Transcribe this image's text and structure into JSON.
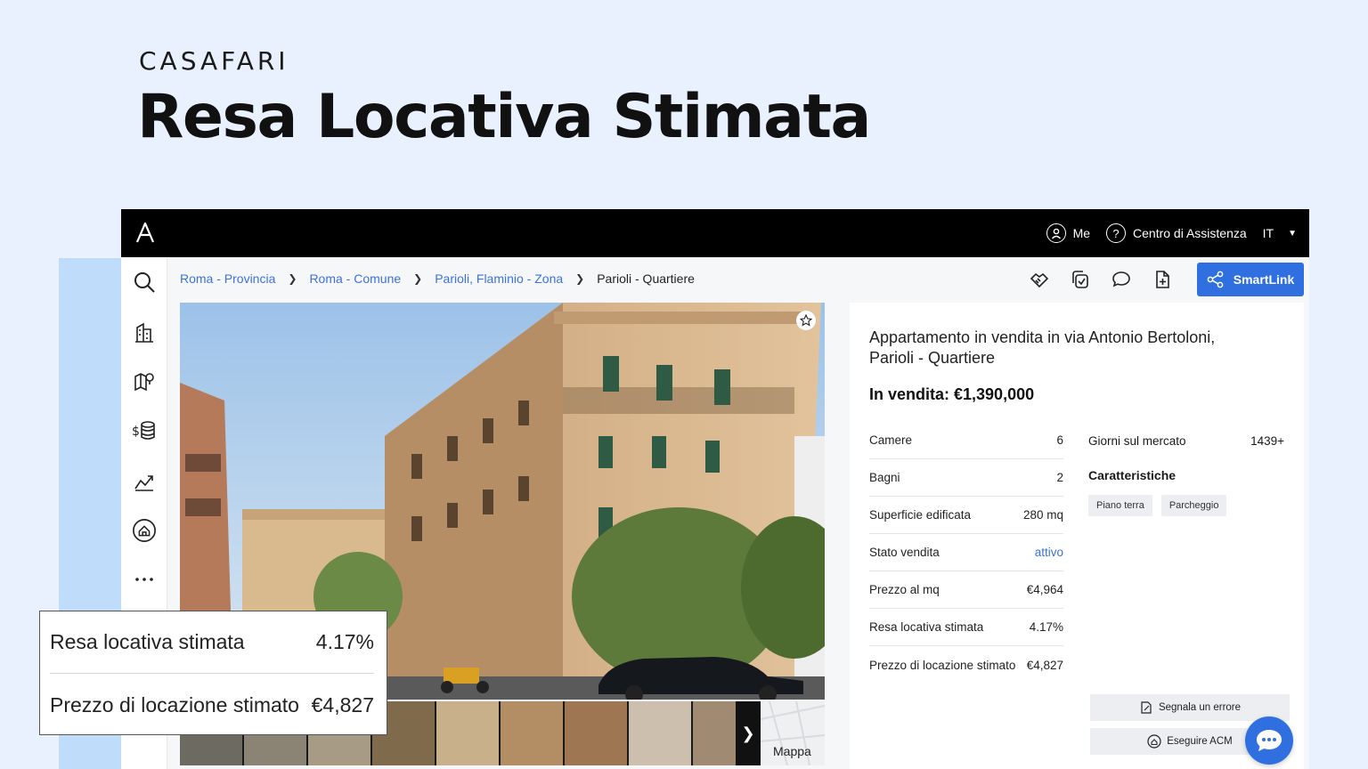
{
  "brand": "CASAFARI",
  "hero_title": "Resa Locativa Stimata",
  "topbar": {
    "me_label": "Me",
    "help_label": "Centro di Assistenza",
    "lang_label": "IT"
  },
  "sidebar": {
    "icons": [
      "search-icon",
      "building-icon",
      "map-pin-icon",
      "money-stack-icon",
      "chart-icon",
      "home-target-icon",
      "more-icon"
    ]
  },
  "breadcrumb": [
    {
      "label": "Roma - Provincia"
    },
    {
      "label": "Roma - Comune"
    },
    {
      "label": "Parioli, Flaminio - Zona"
    },
    {
      "label": "Parioli - Quartiere"
    }
  ],
  "toolbar": {
    "smartlink_label": "SmartLink"
  },
  "gallery": {
    "map_label": "Mappa"
  },
  "listing": {
    "title": "Appartamento in vendita in via Antonio Bertoloni, Parioli - Quartiere",
    "price": "In vendita: €1,390,000",
    "facts": [
      {
        "label": "Camere",
        "value": "6"
      },
      {
        "label": "Bagni",
        "value": "2"
      },
      {
        "label": "Superficie edificata",
        "value": "280 mq"
      },
      {
        "label": "Stato vendita",
        "value": "attivo"
      },
      {
        "label": "Prezzo al mq",
        "value": "€4,964"
      },
      {
        "label": "Resa locativa stimata",
        "value": "4.17%"
      },
      {
        "label": "Prezzo di locazione stimato",
        "value": "€4,827"
      }
    ],
    "days_label": "Giorni sul mercato",
    "days_value": "1439+",
    "features_title": "Caratteristiche",
    "features": [
      "Piano terra",
      "Parcheggio"
    ],
    "report_error_label": "Segnala un errore",
    "acm_label": "Eseguire ACM"
  },
  "callout": {
    "yield_label": "Resa locativa stimata",
    "yield_value": "4.17%",
    "rent_label": "Prezzo di locazione stimato",
    "rent_value": "€4,827"
  },
  "colors": {
    "background": "#e8f1fd",
    "accent": "#2f6fe0",
    "link": "#3b73d6",
    "topbar": "#000000"
  }
}
